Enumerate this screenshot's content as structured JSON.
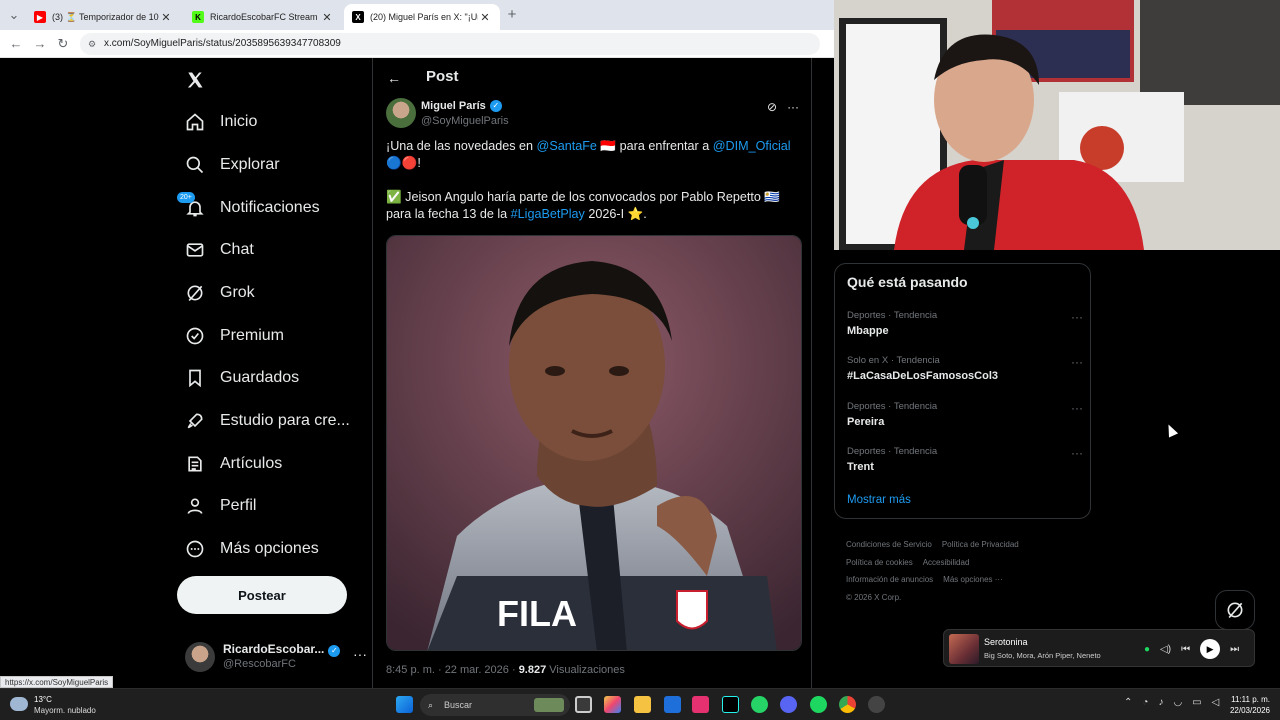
{
  "browser": {
    "tabs": [
      {
        "label": "(3) ⏳ Temporizador de 10 ",
        "icon": "youtube-icon",
        "active": false
      },
      {
        "label": "RicardoEscobarFC Stream - Wa",
        "icon": "kick-icon",
        "active": false
      },
      {
        "label": "(20) Miguel París en X: \"¡Una de",
        "icon": "x-icon",
        "active": true
      }
    ],
    "url": "x.com/SoyMiguelParis/status/2035895639347708309",
    "status_url": "https://x.com/SoyMiguelParis"
  },
  "sidebar": {
    "items": [
      {
        "label": "Inicio",
        "icon": "home-icon"
      },
      {
        "label": "Explorar",
        "icon": "search-icon"
      },
      {
        "label": "Notificaciones",
        "icon": "bell-icon",
        "badge": "20+"
      },
      {
        "label": "Chat",
        "icon": "mail-icon"
      },
      {
        "label": "Grok",
        "icon": "grok-icon"
      },
      {
        "label": "Premium",
        "icon": "verified-icon"
      },
      {
        "label": "Guardados",
        "icon": "bookmark-icon"
      },
      {
        "label": "Estudio para cre...",
        "icon": "rocket-icon"
      },
      {
        "label": "Artículos",
        "icon": "article-icon"
      },
      {
        "label": "Perfil",
        "icon": "person-icon"
      },
      {
        "label": "Más opciones",
        "icon": "more-circle-icon"
      }
    ],
    "post_button": "Postear",
    "profile": {
      "name": "RicardoEscobar...",
      "handle": "@RescobarFC"
    }
  },
  "post": {
    "header": "Post",
    "author_name": "Miguel París",
    "author_handle": "@SoyMiguelParis",
    "text_p1_a": "¡Una de las novedades en ",
    "mention1": "@SantaFe",
    "text_p1_b": " 🇮🇩 para enfrentar a ",
    "mention2": "@DIM_Oficial",
    "text_p1_c": " 🔵🔴!",
    "text_p2_a": "✅ Jeison Angulo haría parte de los convocados por Pablo Repetto 🇺🇾 para la fecha 13 de la ",
    "hashtag": "#LigaBetPlay",
    "text_p2_b": " 2026-I ⭐.",
    "time": "8:45 p. m. · 22 mar. 2026 · ",
    "views_count": "9.827",
    "views_label": " Visualizaciones",
    "image_brand": "FILA"
  },
  "trends": {
    "title": "Qué está pasando",
    "items": [
      {
        "category": "Deportes · Tendencia",
        "name": "Mbappe"
      },
      {
        "category": "Solo en X · Tendencia",
        "name": "#LaCasaDeLosFamososCol3"
      },
      {
        "category": "Deportes · Tendencia",
        "name": "Pereira"
      },
      {
        "category": "Deportes · Tendencia",
        "name": "Trent"
      }
    ],
    "show_more": "Mostrar más"
  },
  "footer": {
    "links": [
      "Condiciones de Servicio",
      "Política de Privacidad",
      "Política de cookies",
      "Accesibilidad",
      "Información de anuncios",
      "Más opciones ···"
    ],
    "copyright": "© 2026 X Corp."
  },
  "player": {
    "song": "Serotonina",
    "artists": "Big Soto, Mora, Arón Piper, Neneto"
  },
  "taskbar": {
    "temperature": "13°C",
    "weather": "Mayorm. nublado",
    "search_placeholder": "Buscar",
    "time": "11:11 p. m.",
    "date": "22/03/2026"
  },
  "colors": {
    "accent": "#1d9bf0",
    "background": "#000000",
    "text": "#e7e9ea",
    "muted": "#71767b"
  }
}
